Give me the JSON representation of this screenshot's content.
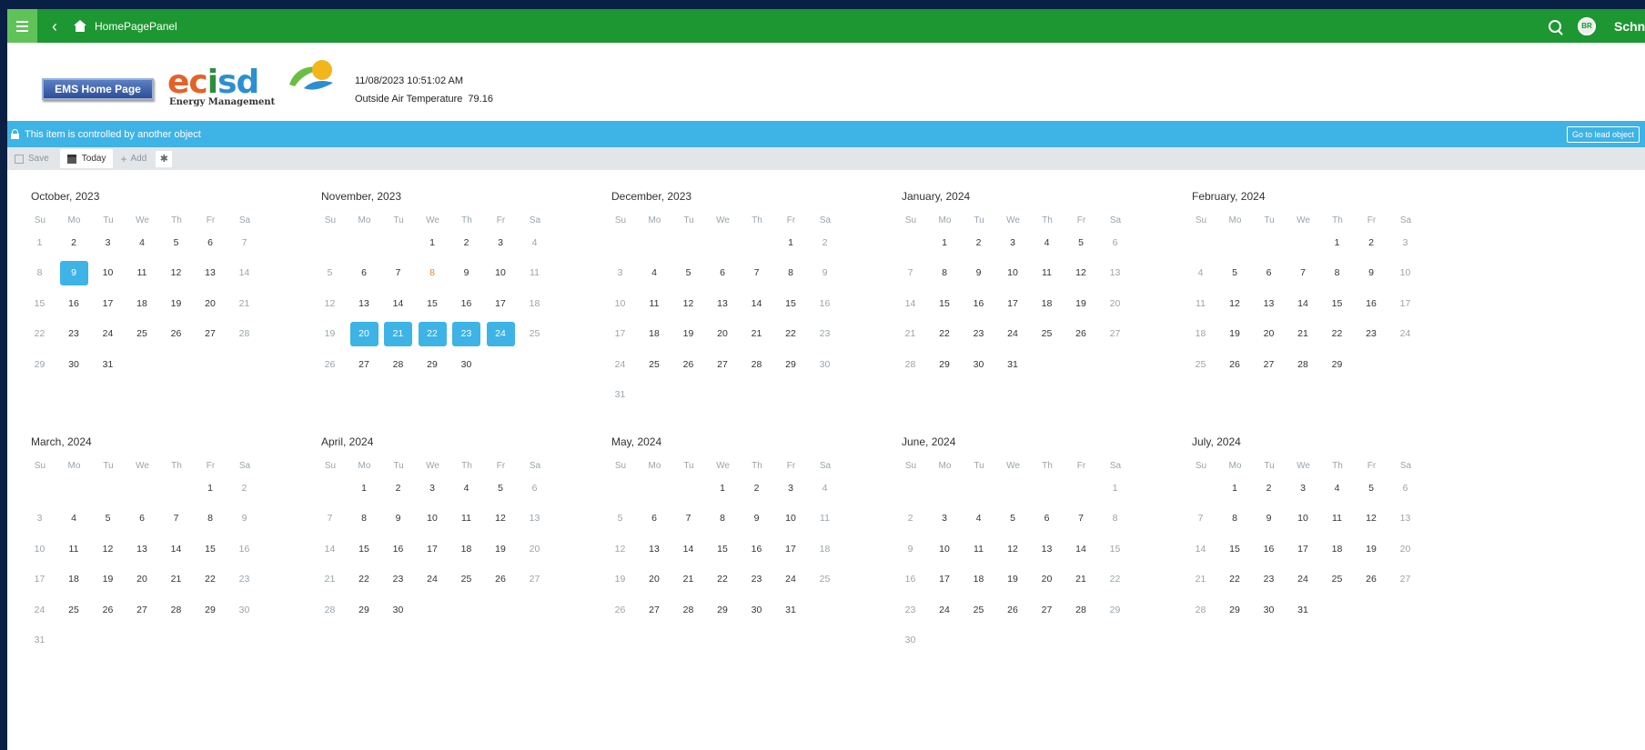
{
  "topbar": {
    "title": "HomePagePanel",
    "avatar": "BR",
    "brand": "Schneider"
  },
  "header": {
    "ems_button": "EMS Home Page",
    "logo_text": "ecisd",
    "logo_sub": "Energy Management",
    "datetime": "11/08/2023 10:51:02 AM",
    "oat_label": "Outside Air Temperature",
    "oat_value": "79.16"
  },
  "infobar": {
    "message": "This item is controlled by another object",
    "lead_button": "Go to lead object"
  },
  "toolbar": {
    "save": "Save",
    "today": "Today",
    "add": "Add"
  },
  "weekdays": [
    "Su",
    "Mo",
    "Tu",
    "We",
    "Th",
    "Fr",
    "Sa"
  ],
  "colors": {
    "topbar": "#1d9731",
    "info": "#3eb3e6",
    "selected": "#3eb3e6",
    "highlight": "#e08a1e"
  },
  "months": [
    {
      "title": "October, 2023",
      "start": 0,
      "days": 31,
      "today": [
        9
      ],
      "selected": [],
      "highlight": []
    },
    {
      "title": "November, 2023",
      "start": 3,
      "days": 30,
      "today": [],
      "selected": [
        20,
        21,
        22,
        23,
        24
      ],
      "highlight": [
        8
      ]
    },
    {
      "title": "December, 2023",
      "start": 5,
      "days": 31,
      "today": [],
      "selected": [],
      "highlight": []
    },
    {
      "title": "January, 2024",
      "start": 1,
      "days": 31,
      "today": [],
      "selected": [],
      "highlight": []
    },
    {
      "title": "February, 2024",
      "start": 4,
      "days": 29,
      "today": [],
      "selected": [],
      "highlight": []
    },
    {
      "title": "March, 2024",
      "start": 5,
      "days": 31,
      "today": [],
      "selected": [],
      "highlight": []
    },
    {
      "title": "April, 2024",
      "start": 1,
      "days": 30,
      "today": [],
      "selected": [],
      "highlight": []
    },
    {
      "title": "May, 2024",
      "start": 3,
      "days": 31,
      "today": [],
      "selected": [],
      "highlight": []
    },
    {
      "title": "June, 2024",
      "start": 6,
      "days": 30,
      "today": [],
      "selected": [],
      "highlight": []
    },
    {
      "title": "July, 2024",
      "start": 1,
      "days": 31,
      "today": [],
      "selected": [],
      "highlight": []
    }
  ]
}
